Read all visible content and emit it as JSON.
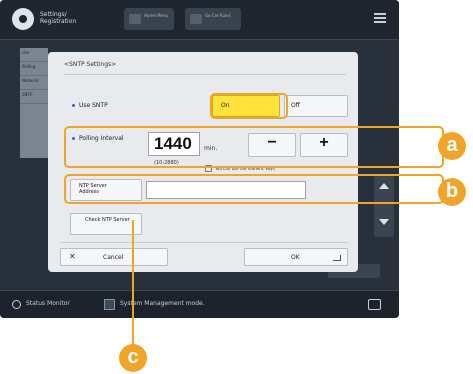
{
  "topbar": {
    "title": "Settings/ Registration",
    "btn1": "Home Menu",
    "btn2": "Go Cre Rules"
  },
  "background": {
    "list_items": [
      "Use",
      "Polling",
      "Network",
      "SNTP"
    ]
  },
  "dialog": {
    "title": "<SNTP Settings>",
    "use_sntp_label": "Use SNTP",
    "on_label": "On",
    "off_label": "Off",
    "polling_label": "Polling Interval",
    "polling_value": "1440",
    "polling_unit": "min.",
    "polling_range": "(10-2880)",
    "keypad_hint": "You can use the numeric keys.",
    "minus_label": "−",
    "plus_label": "+",
    "server_address_label": "NTP Server Address",
    "server_address_value": "",
    "check_server_label": "Check NTP Server",
    "cancel_label": "Cancel",
    "ok_label": "OK"
  },
  "statusbar": {
    "status_monitor": "Status Monitor",
    "mode_text": "System Management mode."
  },
  "callouts": {
    "a": "a",
    "b": "b",
    "c": "c"
  },
  "colors": {
    "accent_on": "#ffe33a",
    "callout": "#f0a52a",
    "screen_bg": "#27303b"
  }
}
